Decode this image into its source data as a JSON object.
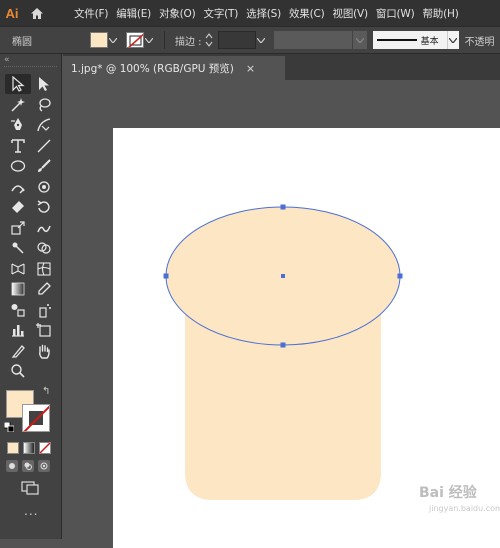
{
  "app": {
    "logo": "Ai",
    "home_icon": "home-icon"
  },
  "menu": [
    {
      "label": "文件(F)"
    },
    {
      "label": "编辑(E)"
    },
    {
      "label": "对象(O)"
    },
    {
      "label": "文字(T)"
    },
    {
      "label": "选择(S)"
    },
    {
      "label": "效果(C)"
    },
    {
      "label": "视图(V)"
    },
    {
      "label": "窗口(W)"
    },
    {
      "label": "帮助(H)"
    }
  ],
  "control_bar": {
    "selection_label": "椭圆",
    "fill_color": "#fde6c3",
    "stroke_label": "描边 :",
    "stroke_value": "",
    "profile_label": "基本",
    "opacity_label": "不透明"
  },
  "document": {
    "tab_title": "1.jpg* @ 100% (RGB/GPU 预览)",
    "close_icon": "×"
  },
  "toolbox": {
    "collapse_icon": "«",
    "fill_color": "#fde6c3",
    "stroke_color": "#ffffff",
    "more_label": "..."
  },
  "artwork": {
    "shape_fill": "#fde6c3",
    "selection_color": "#4a6fd6"
  },
  "watermark": {
    "text": "Bai 经验",
    "sub": "jingyan.baidu.com"
  }
}
